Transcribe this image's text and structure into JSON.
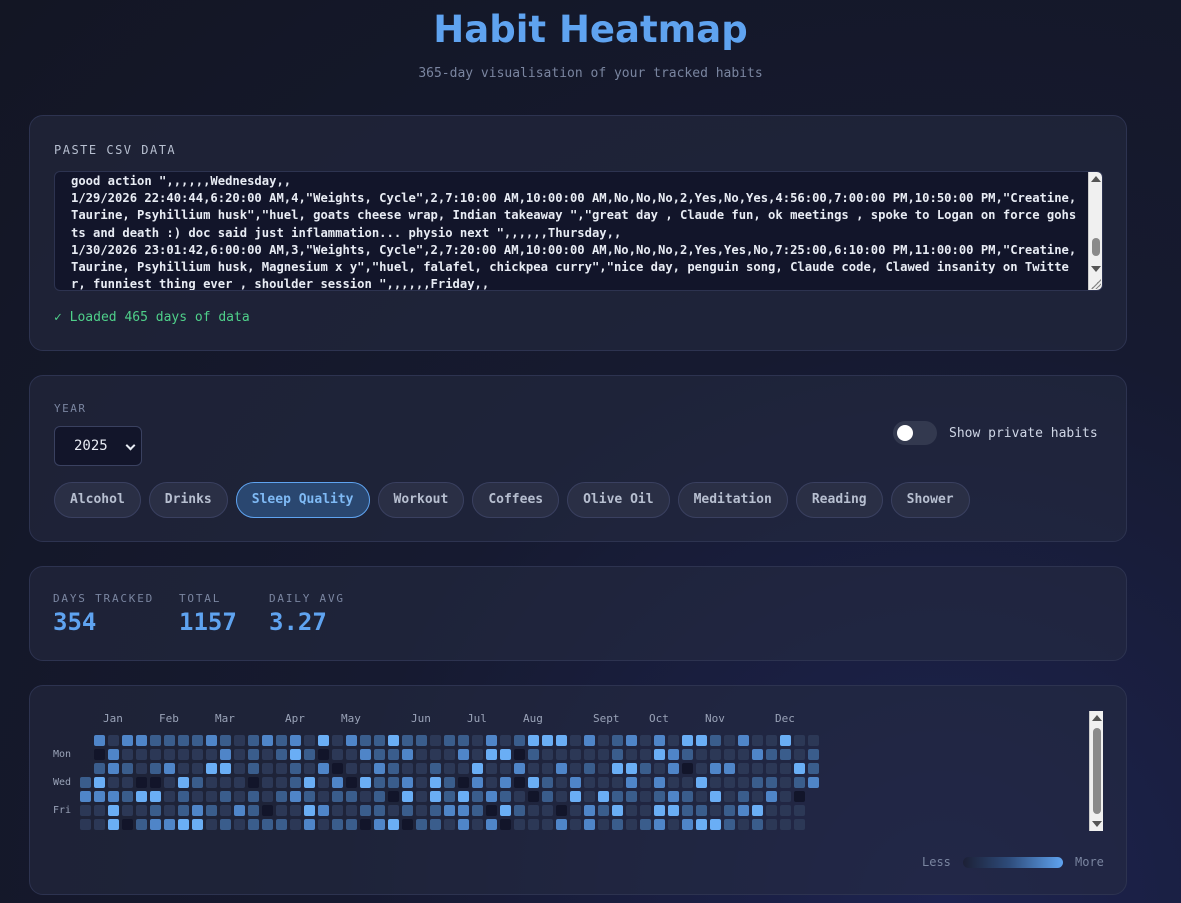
{
  "header": {
    "title": "Habit Heatmap",
    "subtitle": "365-day visualisation of your tracked habits"
  },
  "csv": {
    "label": "PASTE CSV DATA",
    "content": "good action \",,,,,,Wednesday,,\n1/29/2026 22:40:44,6:20:00 AM,4,\"Weights, Cycle\",2,7:10:00 AM,10:00:00 AM,No,No,No,2,Yes,No,Yes,4:56:00,7:00:00 PM,10:50:00 PM,\"Creatine, Taurine, Psyhillium husk\",\"huel, goats cheese wrap, Indian takeaway \",\"great day , Claude fun, ok meetings , spoke to Logan on force gohsts and death :) doc said just inflammation... physio next \",,,,,,Thursday,,\n1/30/2026 23:01:42,6:00:00 AM,3,\"Weights, Cycle\",2,7:20:00 AM,10:00:00 AM,No,No,No,2,Yes,Yes,No,7:25:00,6:10:00 PM,11:00:00 PM,\"Creatine, Taurine, Psyhillium husk, Magnesium x y\",\"huel, falafel, chickpea curry\",\"nice day, penguin song, Claude code, Clawed insanity on Twitter, funniest thing ever , shoulder session \",,,,,,Friday,,",
    "status": "✓ Loaded 465 days of data"
  },
  "controls": {
    "year_label": "YEAR",
    "year_value": "2025",
    "toggle_label": "Show private habits",
    "habits": [
      "Alcohol",
      "Drinks",
      "Sleep Quality",
      "Workout",
      "Coffees",
      "Olive Oil",
      "Meditation",
      "Reading",
      "Shower"
    ],
    "active_habit": "Sleep Quality"
  },
  "stats": {
    "days_tracked_label": "DAYS TRACKED",
    "days_tracked": "354",
    "total_label": "TOTAL",
    "total": "1157",
    "avg_label": "DAILY AVG",
    "avg": "3.27"
  },
  "heatmap": {
    "months": [
      "Jan",
      "Feb",
      "Mar",
      "Apr",
      "May",
      "Jun",
      "Jul",
      "Aug",
      "Sept",
      "Oct",
      "Nov",
      "Dec"
    ],
    "month_weeks": [
      1,
      5,
      9,
      14,
      18,
      23,
      27,
      31,
      36,
      40,
      44,
      49
    ],
    "day_labels": [
      "Mon",
      "Wed",
      "Fri"
    ],
    "first_weekday": 3,
    "level_seed": 2025,
    "level_colors": [
      "#12152a",
      "#2c3856",
      "#3a5d8c",
      "#4f85c8",
      "#6aaef5"
    ],
    "legend_less": "Less",
    "legend_more": "More"
  }
}
